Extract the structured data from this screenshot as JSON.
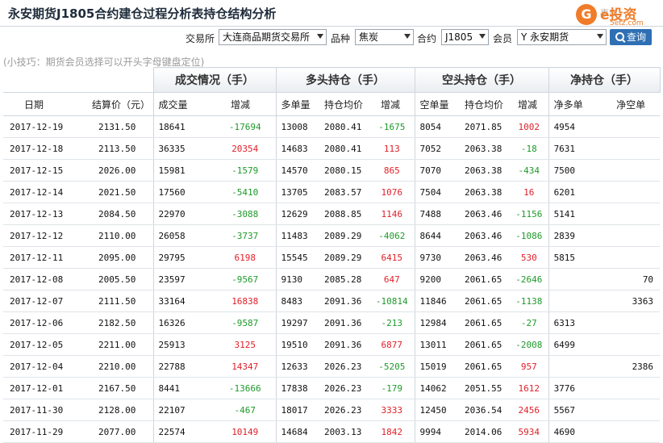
{
  "title": "永安期货J1805合约建仓过程分析表持仓结构分析",
  "logo": {
    "brand": "e投资",
    "sub": "5etz.com",
    "icon_glyph": "G",
    "peek_text": "事口"
  },
  "filters": {
    "exchange_label": "交易所",
    "exchange_value": "大连商品期货交易所",
    "variety_label": "品种",
    "variety_value": "焦炭",
    "contract_label": "合约",
    "contract_value": "J1805",
    "member_label": "会员",
    "member_value": "Y 永安期货",
    "query_label": "查询"
  },
  "tip": "(小技巧：期货会员选择可以开头字母键盘定位)",
  "colors": {
    "positive": "#e0202a",
    "negative": "#1d9a2a",
    "button": "#2f6fb4",
    "accent": "#f07c2a"
  },
  "table": {
    "groups": [
      "成交情况（手）",
      "多头持仓（手）",
      "空头持仓（手）",
      "净持仓（手）"
    ],
    "columns": [
      "日期",
      "结算价（元）",
      "成交量",
      "增减",
      "多单量",
      "持仓均价",
      "增减",
      "空单量",
      "持仓均价",
      "增减",
      "净多单",
      "净空单"
    ],
    "rows": [
      [
        "2017-12-19",
        "2131.50",
        "18641",
        "-17694",
        "13008",
        "2080.41",
        "-1675",
        "8054",
        "2071.85",
        "1002",
        "4954",
        ""
      ],
      [
        "2017-12-18",
        "2113.50",
        "36335",
        "20354",
        "14683",
        "2080.41",
        "113",
        "7052",
        "2063.38",
        "-18",
        "7631",
        ""
      ],
      [
        "2017-12-15",
        "2026.00",
        "15981",
        "-1579",
        "14570",
        "2080.15",
        "865",
        "7070",
        "2063.38",
        "-434",
        "7500",
        ""
      ],
      [
        "2017-12-14",
        "2021.50",
        "17560",
        "-5410",
        "13705",
        "2083.57",
        "1076",
        "7504",
        "2063.38",
        "16",
        "6201",
        ""
      ],
      [
        "2017-12-13",
        "2084.50",
        "22970",
        "-3088",
        "12629",
        "2088.85",
        "1146",
        "7488",
        "2063.46",
        "-1156",
        "5141",
        ""
      ],
      [
        "2017-12-12",
        "2110.00",
        "26058",
        "-3737",
        "11483",
        "2089.29",
        "-4062",
        "8644",
        "2063.46",
        "-1086",
        "2839",
        ""
      ],
      [
        "2017-12-11",
        "2095.00",
        "29795",
        "6198",
        "15545",
        "2089.29",
        "6415",
        "9730",
        "2063.46",
        "530",
        "5815",
        ""
      ],
      [
        "2017-12-08",
        "2005.50",
        "23597",
        "-9567",
        "9130",
        "2085.28",
        "647",
        "9200",
        "2061.65",
        "-2646",
        "",
        "70"
      ],
      [
        "2017-12-07",
        "2111.50",
        "33164",
        "16838",
        "8483",
        "2091.36",
        "-10814",
        "11846",
        "2061.65",
        "-1138",
        "",
        "3363"
      ],
      [
        "2017-12-06",
        "2182.50",
        "16326",
        "-9587",
        "19297",
        "2091.36",
        "-213",
        "12984",
        "2061.65",
        "-27",
        "6313",
        ""
      ],
      [
        "2017-12-05",
        "2211.00",
        "25913",
        "3125",
        "19510",
        "2091.36",
        "6877",
        "13011",
        "2061.65",
        "-2008",
        "6499",
        ""
      ],
      [
        "2017-12-04",
        "2210.00",
        "22788",
        "14347",
        "12633",
        "2026.23",
        "-5205",
        "15019",
        "2061.65",
        "957",
        "",
        "2386"
      ],
      [
        "2017-12-01",
        "2167.50",
        "8441",
        "-13666",
        "17838",
        "2026.23",
        "-179",
        "14062",
        "2051.55",
        "1612",
        "3776",
        ""
      ],
      [
        "2017-11-30",
        "2128.00",
        "22107",
        "-467",
        "18017",
        "2026.23",
        "3333",
        "12450",
        "2036.54",
        "2456",
        "5567",
        ""
      ],
      [
        "2017-11-29",
        "2077.00",
        "22574",
        "10149",
        "14684",
        "2003.13",
        "1842",
        "9994",
        "2014.06",
        "5934",
        "4690",
        ""
      ]
    ]
  }
}
